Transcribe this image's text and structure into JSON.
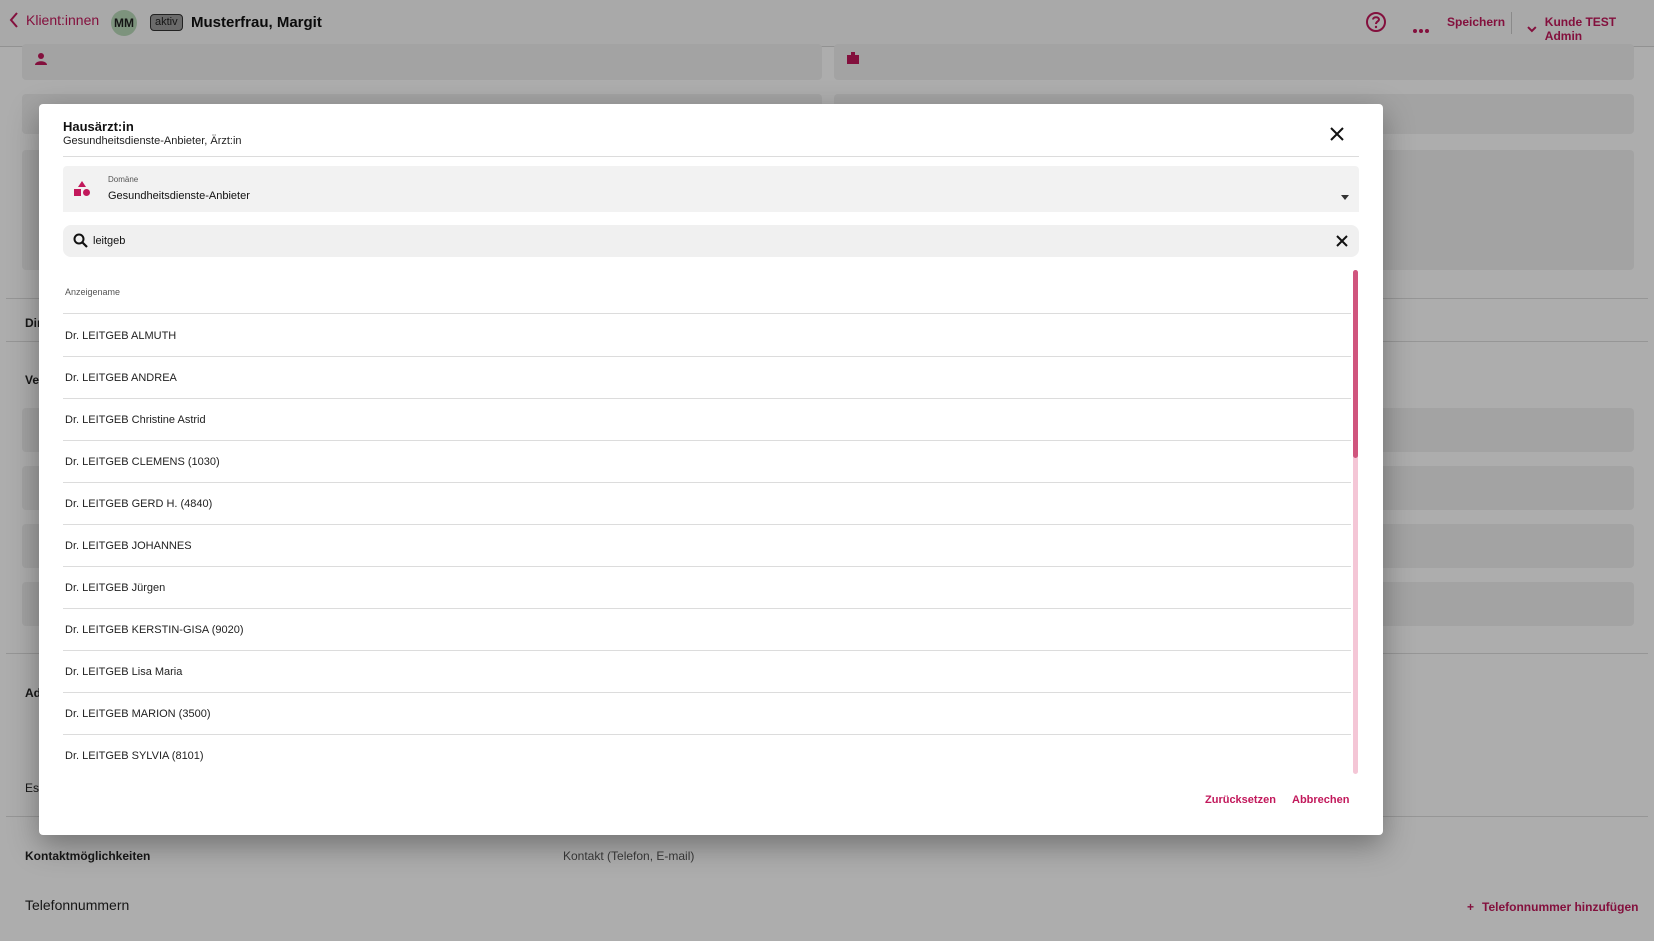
{
  "topbar": {
    "back_label": "Klient:innen",
    "avatar_initials": "MM",
    "status": "aktiv",
    "client_name": "Musterfrau, Margit",
    "save_label": "Speichern",
    "account_label": "Kunde TEST Admin"
  },
  "background": {
    "section_contacts_title": "Kontaktmöglichkeiten",
    "section_contacts_summary": "Kontakt (Telefon, E-mail)",
    "phones_title": "Telefonnummern",
    "add_phone_label": "Telefonnummer hinzufügen",
    "partial_labels": [
      "Dir",
      "Ve",
      "Ad",
      "Es"
    ]
  },
  "dialog": {
    "title": "Hausärzt:in",
    "subtitle": "Gesundheitsdienste-Anbieter, Ärzt:in",
    "domain_label": "Domäne",
    "domain_value": "Gesundheitsdienste-Anbieter",
    "search_value": "leitgeb",
    "column_header": "Anzeigename",
    "results": [
      "Dr. LEITGEB ALMUTH",
      "Dr. LEITGEB ANDREA",
      "Dr. LEITGEB Christine Astrid",
      "Dr. LEITGEB CLEMENS (1030)",
      "Dr. LEITGEB GERD H. (4840)",
      "Dr. LEITGEB JOHANNES",
      "Dr. LEITGEB Jürgen",
      "Dr. LEITGEB KERSTIN-GISA (9020)",
      "Dr. LEITGEB Lisa Maria",
      "Dr. LEITGEB MARION (3500)",
      "Dr. LEITGEB SYLVIA (8101)"
    ],
    "reset_label": "Zurücksetzen",
    "cancel_label": "Abbrechen"
  },
  "colors": {
    "accent": "#c2185b",
    "scroll_thumb": "#d0557e",
    "scroll_track": "#f4c6d6"
  }
}
